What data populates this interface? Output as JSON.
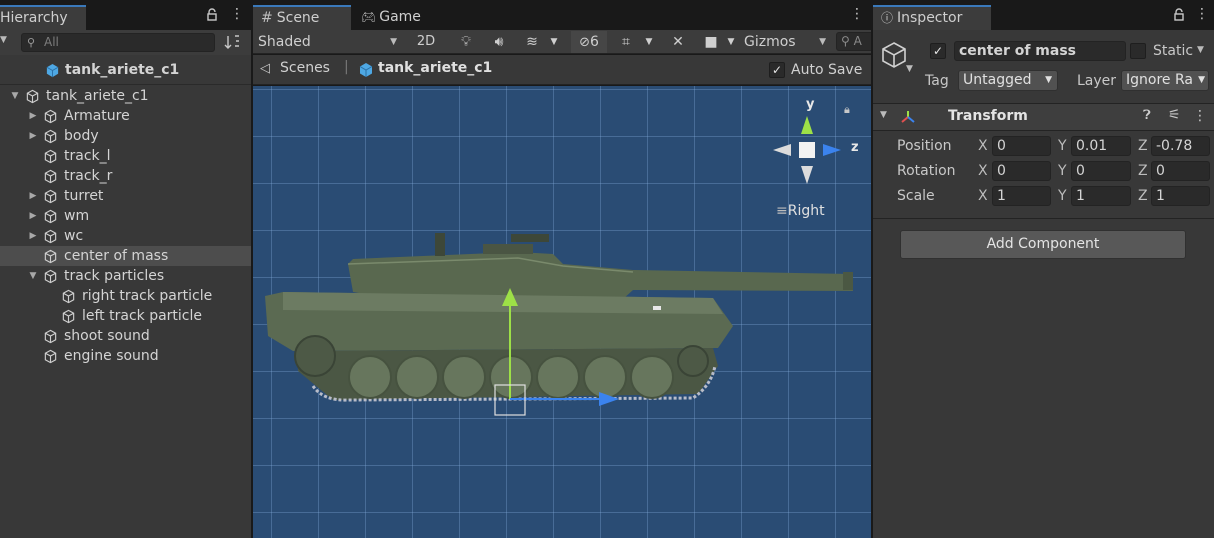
{
  "hierarchy": {
    "tab_label": "Hierarchy",
    "search_placeholder": "All",
    "root_label": "tank_ariete_c1",
    "items": [
      {
        "label": "tank_ariete_c1"
      },
      {
        "label": "Armature"
      },
      {
        "label": "body"
      },
      {
        "label": "track_l"
      },
      {
        "label": "track_r"
      },
      {
        "label": "turret"
      },
      {
        "label": "wm"
      },
      {
        "label": "wc"
      },
      {
        "label": "center of mass"
      },
      {
        "label": "track particles"
      },
      {
        "label": "right track particle"
      },
      {
        "label": "left track particle"
      },
      {
        "label": "shoot sound"
      },
      {
        "label": "engine sound"
      }
    ]
  },
  "scene": {
    "tab_scene": "Scene",
    "tab_game": "Game",
    "shading_mode": "Shaded",
    "btn_2d": "2D",
    "hidden_count": "6",
    "gizmos_label": "Gizmos",
    "search_placeholder": "A",
    "breadcrumb_root": "Scenes",
    "breadcrumb_current": "tank_ariete_c1",
    "auto_save_label": "Auto Save",
    "gizmo_y": "y",
    "gizmo_z": "z",
    "view_label": "Right"
  },
  "inspector": {
    "tab_label": "Inspector",
    "object_name": "center of mass",
    "static_label": "Static",
    "tag_label": "Tag",
    "tag_value": "Untagged",
    "layer_label": "Layer",
    "layer_value": "Ignore Ra",
    "transform_title": "Transform",
    "position_label": "Position",
    "rotation_label": "Rotation",
    "scale_label": "Scale",
    "axis_x": "X",
    "axis_y": "Y",
    "axis_z": "Z",
    "position": {
      "x": "0",
      "y": "0.01",
      "z": "-0.78"
    },
    "rotation": {
      "x": "0",
      "y": "0",
      "z": "0"
    },
    "scale": {
      "x": "1",
      "y": "1",
      "z": "1"
    },
    "add_component_label": "Add Component"
  },
  "colors": {
    "accent": "#3a79bb",
    "viewport_bg": "#2a4c74",
    "panel_bg": "#383838",
    "selection_bg": "#4d4d4d"
  }
}
